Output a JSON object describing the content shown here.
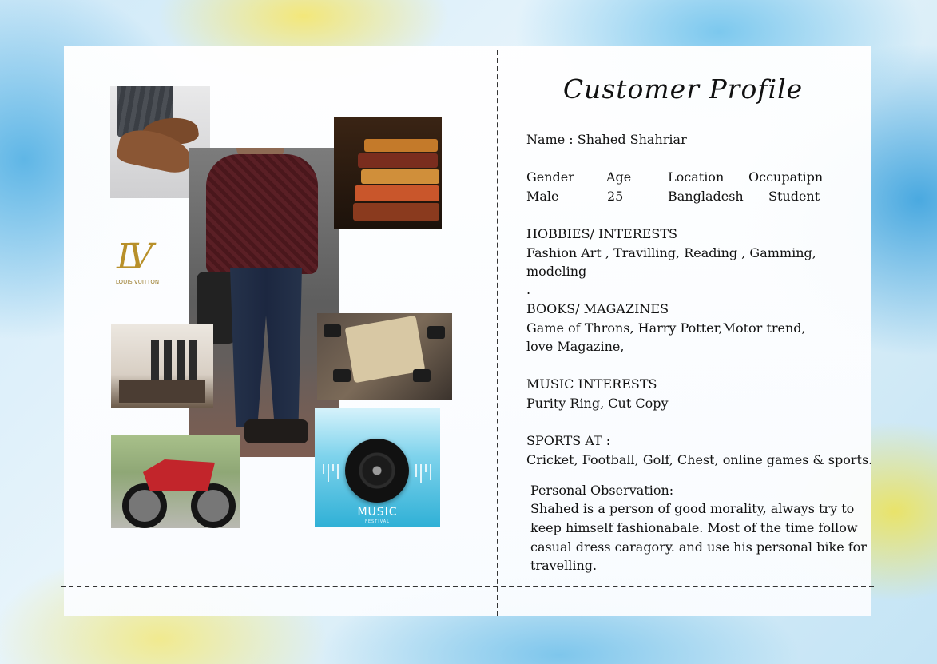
{
  "profile": {
    "title": "Customer Profile",
    "name_line": "Name : Shahed Shahriar",
    "headers": {
      "gender": "Gender",
      "age": "Age",
      "location": "Location",
      "occupation": "Occupatipn"
    },
    "values": {
      "gender": "Male",
      "age": "25",
      "location": "Bangladesh",
      "occupation": "Student"
    },
    "hobbies_heading": "HOBBIES/ INTERESTS",
    "hobbies_line1": "Fashion Art , Travilling, Reading , Gamming,",
    "hobbies_line2": "modeling",
    "hobbies_line3": ".",
    "books_heading": "BOOKS/ MAGAZINES",
    "books_line1": "Game of Throns, Harry Potter,Motor trend,",
    "books_line2": "love Magazine,",
    "music_heading": "MUSIC INTERESTS",
    "music_line": "Purity Ring, Cut Copy",
    "sports_heading": "SPORTS AT :",
    "sports_line": "Cricket, Football, Golf, Chest, online games & sports.",
    "observation_heading": "Personal Observation:",
    "observation_line1": "Shahed is a person of good morality, always try to",
    "observation_line2": "keep himself fashionabale. Most of the time follow",
    "observation_line3": "casual dress caragory. and use his personal bike for",
    "observation_line4": "travelling."
  },
  "images": {
    "logo_text": "LV",
    "logo_caption": "LOUIS VUITTON",
    "music_title": "MUSIC",
    "music_sub": "FESTIVAL"
  }
}
